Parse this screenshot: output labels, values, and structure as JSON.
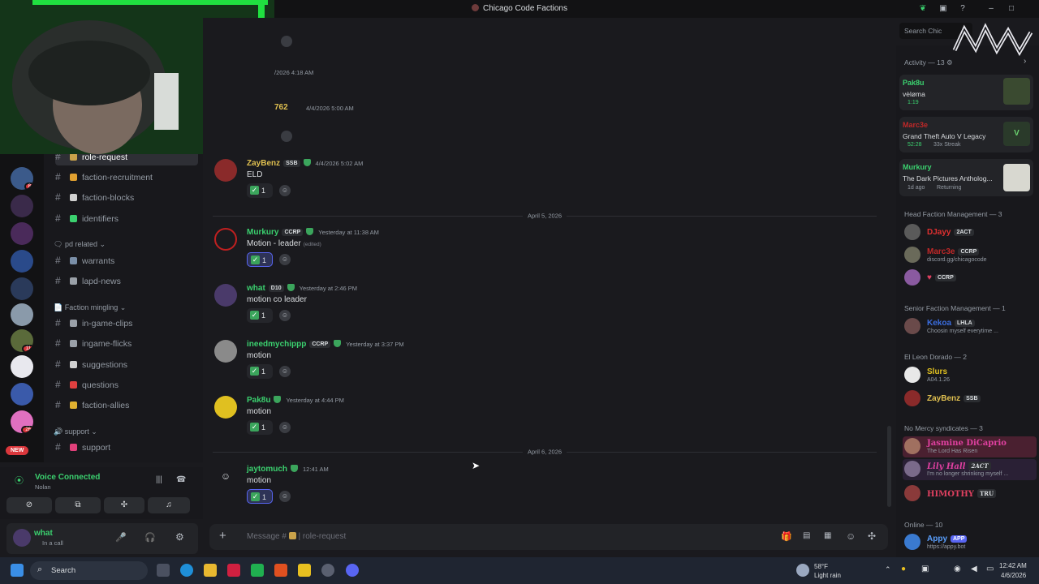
{
  "window": {
    "title": "Chicago Code Factions"
  },
  "header": {
    "channel": "role-request",
    "search_placeholder": "Search Chic"
  },
  "server_badges": [
    "8",
    "11",
    "26"
  ],
  "new_pill": "NEW",
  "channels": [
    {
      "name": "role-request",
      "emoji_color": "#c9a24a",
      "active": true
    },
    {
      "name": "faction-recruitment",
      "emoji_color": "#e0a030"
    },
    {
      "name": "faction-blocks",
      "emoji_color": "#d0d0d0"
    },
    {
      "name": "identifiers",
      "emoji_color": "#3bd16f"
    },
    {
      "name": "warrants",
      "emoji_color": "#7a8fa8"
    },
    {
      "name": "lapd-news",
      "emoji_color": "#9aa0a8"
    },
    {
      "name": "in-game-clips",
      "emoji_color": "#9aa0a8"
    },
    {
      "name": "ingame-flicks",
      "emoji_color": "#9aa0a8"
    },
    {
      "name": "suggestions",
      "emoji_color": "#d0d0d0"
    },
    {
      "name": "questions",
      "emoji_color": "#e04040"
    },
    {
      "name": "faction-allies",
      "emoji_color": "#e0b030"
    },
    {
      "name": "support",
      "emoji_color": "#e0407a"
    }
  ],
  "categories": [
    "pd related",
    "Faction mingling",
    "support"
  ],
  "voice": {
    "status": "Voice Connected",
    "channel": "Nolan"
  },
  "user": {
    "name": "what",
    "status": "In a call"
  },
  "messages_partial": [
    {
      "ts": "/2026 4:18 AM"
    },
    {
      "name": "762",
      "ts": "4/4/2026 5:00 AM"
    }
  ],
  "messages": [
    {
      "name": "ZayBenz",
      "color": "#e0c050",
      "tag": "SSB",
      "ts": "4/4/2026 5:02 AM",
      "text": "ELD",
      "count": "1",
      "me": false,
      "avatar": "#8a2a2a"
    },
    {
      "name": "Murkury",
      "color": "#3bd16f",
      "tag": "CCRP",
      "ts": "Yesterday at 11:38 AM",
      "text": "Motion - leader",
      "edited": "(edited)",
      "count": "1",
      "me": true,
      "avatar": "#c02020"
    },
    {
      "name": "what",
      "color": "#3bd16f",
      "tag": "D10",
      "ts": "Yesterday at 2:46 PM",
      "text": "motion co leader",
      "count": "1",
      "me": false,
      "avatar": "#4a3a6a"
    },
    {
      "name": "ineedmychippp",
      "color": "#3bd16f",
      "tag": "CCRP",
      "ts": "Yesterday at 3:37 PM",
      "text": "motion",
      "count": "1",
      "me": false,
      "avatar": "#8a8a8a"
    },
    {
      "name": "Pak8u",
      "color": "#3bd16f",
      "tag": "",
      "ts": "Yesterday at 4:44 PM",
      "text": "motion",
      "count": "1",
      "me": false,
      "avatar": "#e0c020"
    },
    {
      "name": "jaytomuch",
      "color": "#3bd16f",
      "tag": "",
      "ts": "12:41 AM",
      "text": "motion",
      "count": "1",
      "me": true,
      "avatar": "#1a1a1e"
    }
  ],
  "dividers": [
    "April 5, 2026",
    "April 6, 2026"
  ],
  "composer": {
    "placeholder": "Message #",
    "channel": "role-request"
  },
  "activity": {
    "title": "Activity — 13",
    "cards": [
      {
        "name": "Pak8u",
        "color": "#3bd16f",
        "line1": "vėlømа",
        "line2": "1:19"
      },
      {
        "name": "Marc3e",
        "color": "#c02828",
        "line1": "Grand Theft Auto V Legacy",
        "line2": "52:28",
        "line3": "33x Streak"
      },
      {
        "name": "Murkury",
        "color": "#3bd16f",
        "line1": "The Dark Pictures Antholog...",
        "line2": "1d ago",
        "line3": "Returning"
      }
    ]
  },
  "member_groups": [
    {
      "title": "Head Faction Management — 3",
      "members": [
        {
          "name": "DJayy",
          "color": "#e03030",
          "tag": "2ACT",
          "status": ""
        },
        {
          "name": "Marc3e",
          "color": "#c02828",
          "tag": "CCRP",
          "status": "discord.gg/chicagocode"
        },
        {
          "name": "",
          "color": "#e04060",
          "tag": "CCRP",
          "status": ""
        }
      ]
    },
    {
      "title": "Senior Faction Management — 1",
      "members": [
        {
          "name": "Kekoa",
          "color": "#3b6ee0",
          "tag": "LHLA",
          "status": "Choosin myself everytime ..."
        }
      ]
    },
    {
      "title": "El Leon Dorado — 2",
      "members": [
        {
          "name": "Slurs",
          "color": "#e0c020",
          "tag": "",
          "status": "A04.1.26"
        },
        {
          "name": "ZayBenz",
          "color": "#e0c050",
          "tag": "SSB",
          "status": ""
        }
      ]
    },
    {
      "title": "No Mercy syndicates — 3",
      "members": [
        {
          "name": "Jasmine DiCaprio",
          "color": "#e040a0",
          "tag": "",
          "status": "The Lord Has Risen"
        },
        {
          "name": "Lily Hall",
          "color": "#e040a0",
          "tag": "2ACT",
          "status": "I'm no longer shrinking myself ..."
        },
        {
          "name": "HIMOTHY",
          "color": "#e04060",
          "tag": "TRU",
          "status": ""
        }
      ]
    },
    {
      "title": "Online — 10",
      "members": [
        {
          "name": "Appy",
          "color": "#5aa0ff",
          "tag": "APP",
          "status": "https://appy.bot"
        }
      ]
    }
  ],
  "taskbar": {
    "search": "Search",
    "weather_temp": "58°F",
    "weather_desc": "Light rain",
    "time": "12:42 AM",
    "date": "4/6/2026"
  }
}
